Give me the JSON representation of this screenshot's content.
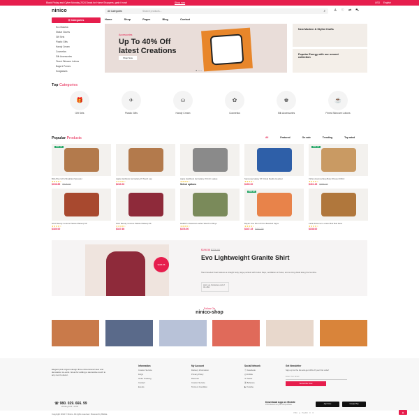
{
  "topbar": {
    "message": "Black Friday and Cyber Monday 2024 Deals for Home Shoppers, grab it now!",
    "cta": "Shop now",
    "currency": "USD",
    "language": "English"
  },
  "header": {
    "logo": "ninico",
    "search_category": "All Categories",
    "search_placeholder": "Search products..."
  },
  "nav": {
    "categories_button": "Categories",
    "items": [
      "Home",
      "Shop",
      "Pages",
      "Blog",
      "Contact"
    ]
  },
  "sidebar_categories": [
    "Eco Maseka",
    "Statue Gloves",
    "Gift Sets",
    "Plastic Gifts",
    "Handy Cream",
    "Cosmetics",
    "Silk Accessories",
    "Finest Skincare Lotions",
    "Bags & Purses",
    "Sunglasses"
  ],
  "hero": {
    "subtitle": "Accessories",
    "title_line1": "Up To 40% Off",
    "title_line2": "latest Creations",
    "cta": "Shop Now"
  },
  "side_banners": [
    {
      "title": "New Modern & Stylist Crafts"
    },
    {
      "title": "Popular Energy with our newest collection"
    }
  ],
  "top_categories": {
    "title": "Top",
    "title_accent": "Categories",
    "items": [
      "Gift Sets",
      "Plastic Gifts",
      "Handy Cream",
      "Cosmetics",
      "Silk Accessories",
      "Finest Skincare Lotions"
    ]
  },
  "popular": {
    "title": "Popular",
    "title_accent": "Products",
    "tabs": [
      "All",
      "Featured",
      "On sale",
      "Trending",
      "Top rated"
    ]
  },
  "products": [
    {
      "name": "BAA Plus Grit's Breakfast Spreader",
      "price": "$196.85",
      "old": "$245.90",
      "badge": "25% off",
      "color": "#b37a4c"
    },
    {
      "name": "Apple Hardbook 4ai Galaxy 15 Touch Lap",
      "price": "$240.00",
      "old": "",
      "badge": "",
      "color": "#b37a4c"
    },
    {
      "name": "Apple Hardbook 4ai Galaxy 15 Inch Laptop",
      "price": "",
      "old": "",
      "badge": "",
      "color": "#8a8a8a",
      "extra": "Select options"
    },
    {
      "name": "Samsung Galaxy 9X Virtual Reality Headset",
      "price": "$409.00",
      "old": "",
      "badge": "",
      "color": "#2e5fa8"
    },
    {
      "name": "Vishnu Hammerfang Body Shower 400ml",
      "price": "$401.45",
      "old": "$456.00",
      "badge": "25% off",
      "color": "#c99a63"
    },
    {
      "name": "NOX Beauty Couture Palette Makeup 5K",
      "price": "$439.00",
      "old": "",
      "badge": "",
      "color": "#a8492f"
    },
    {
      "name": "NOX Beauty Couture Palette Makeup 5K",
      "price": "$347.66",
      "old": "",
      "badge": "",
      "color": "#8e2a3a"
    },
    {
      "name": "KEMO'S Classical Leather Watch for Boys",
      "price": "$376.50",
      "old": "",
      "badge": "",
      "color": "#7a8a5a"
    },
    {
      "name": "Bayler One Shot 2X Per Bearded Signs",
      "price": "$347.15",
      "old": "$442.00",
      "badge": "25% off",
      "color": "#e8834a"
    },
    {
      "name": "Fable Pokemon Lucario Butt Butt Faire",
      "price": "$158.00",
      "old": "",
      "badge": "",
      "color": "#b0773c"
    }
  ],
  "promo": {
    "price": "$196.56",
    "old_price": "$276.00",
    "badge": "$196.56",
    "title": "Evo Lightweight Granite Shirt",
    "description": "Short Hooded Coat features a straight body, large pockets with button flaps, ventilation air holes, and a string detail along the hemline.",
    "countdown": "Hurry up, Deliveries end of the offer"
  },
  "follow": {
    "label": "Follow On",
    "handle": "ninico-shop"
  },
  "footer": {
    "about": "Elegant pink origami design three dimensional view and decoration co-exist. Great for adding a decorative touch to any room's decor.",
    "phone": "980. 029. 666. 99",
    "phone_sub": "Working 8:00 - 22:00",
    "information": {
      "title": "Information",
      "links": [
        "Custom Service",
        "FAQs",
        "Order Tracking",
        "Contact",
        "Events"
      ]
    },
    "account": {
      "title": "My Account",
      "links": [
        "Delivery Information",
        "Privacy Policy",
        "Discount",
        "Custom Service",
        "Terms & Condition"
      ]
    },
    "social": {
      "title": "Social Network",
      "links": [
        "Facebook",
        "Dribble",
        "Twitter",
        "Behance",
        "Youtube"
      ]
    },
    "newsletter": {
      "title": "Get Newsletter",
      "text": "Sign up for the list and get 10% off your first order!",
      "placeholder": "Enter Your Email",
      "button": "Subscribe Now"
    },
    "app": {
      "title": "Download App on Mobile",
      "sub": "15% discount on your first purchase",
      "app_store": "App Store",
      "google_play": "Google Play"
    },
    "copyright": "Copyright 2024 © Ninico. All rights reserved. Powered by Bolt&s."
  },
  "colors": {
    "accent": "#e61e4d",
    "badge": "#2ba86b"
  }
}
